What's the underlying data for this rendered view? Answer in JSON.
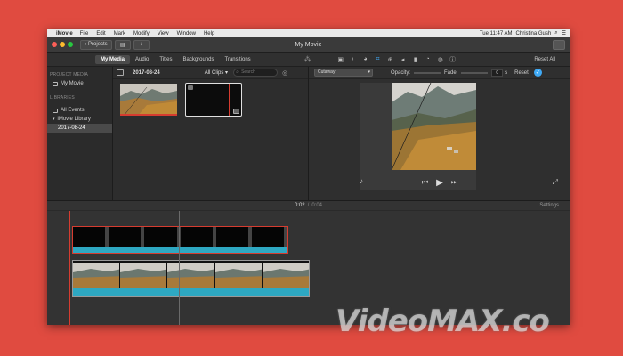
{
  "menubar": {
    "app": "iMovie",
    "items": [
      "File",
      "Edit",
      "Mark",
      "Modify",
      "View",
      "Window",
      "Help"
    ],
    "clock": "Tue 11:47 AM",
    "user": "Christina Gush"
  },
  "titlebar": {
    "projects_label": "Projects",
    "title": "My Movie"
  },
  "toolbar": {
    "tabs": [
      {
        "label": "My Media",
        "active": true
      },
      {
        "label": "Audio",
        "active": false
      },
      {
        "label": "Titles",
        "active": false
      },
      {
        "label": "Backgrounds",
        "active": false
      },
      {
        "label": "Transitions",
        "active": false
      }
    ],
    "reset_all": "Reset All"
  },
  "sidebar": {
    "project_media_heading": "PROJECT MEDIA",
    "project_item": "My Movie",
    "libraries_heading": "LIBRARIES",
    "all_events": "All Events",
    "library": "iMovie Library",
    "event_date": "2017-08-24"
  },
  "browser": {
    "date": "2017-08-24",
    "filter": "All Clips",
    "search_placeholder": "Search"
  },
  "viewer": {
    "overlay_mode": "Cutaway",
    "opacity_label": "Opacity:",
    "fade_label": "Fade:",
    "fade_value": "0",
    "fade_unit": "s",
    "reset": "Reset"
  },
  "timeline": {
    "current_time": "0:02",
    "separator": "/",
    "duration": "0:04",
    "settings": "Settings"
  },
  "watermark": "VideoMAX.co",
  "colors": {
    "background": "#e04b40",
    "accent": "#3fa9f5",
    "playhead": "#d63c30",
    "audio_wave": "#2ea8c2"
  }
}
